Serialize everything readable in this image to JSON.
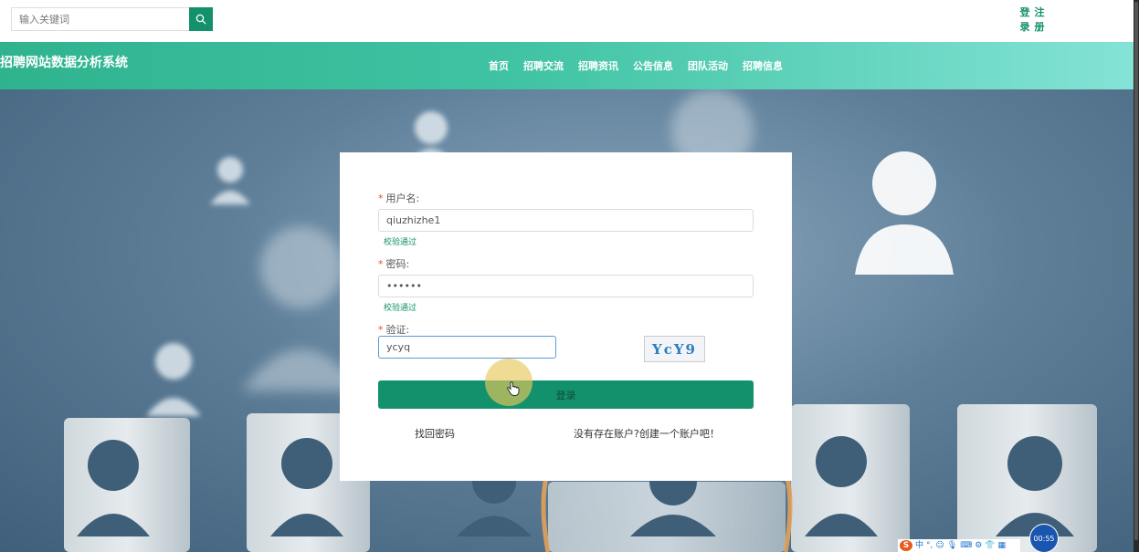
{
  "search": {
    "placeholder": "输入关键词"
  },
  "auth": {
    "login_chars": [
      "登",
      "录"
    ],
    "register_chars": [
      "注",
      "册"
    ]
  },
  "brand": {
    "title": "招聘网站数据分析系统"
  },
  "nav": {
    "items": [
      "首页",
      "招聘交流",
      "招聘资讯",
      "公告信息",
      "团队活动",
      "招聘信息"
    ]
  },
  "form": {
    "username": {
      "label": "用户名:",
      "value": "qiuzhizhe1",
      "hint": "校验通过"
    },
    "password": {
      "label": "密码:",
      "value": "••••••",
      "hint": "校验通过"
    },
    "captcha": {
      "label": "验证:",
      "value": "ycyq",
      "image_text": "YcY9"
    },
    "login_label": "登录",
    "forgot_label": "找回密码",
    "register_label": "没有存在账户?创建一个账户吧！"
  },
  "ime": {
    "logo": "S",
    "mode": "中",
    "items": [
      "°,",
      "☺",
      "🎙",
      "⌨",
      "⚙",
      "👕",
      "▦"
    ]
  },
  "timer": {
    "label": "00:55"
  },
  "colors": {
    "accent": "#13906c",
    "nav_gradient_start": "#2fb38f",
    "nav_gradient_end": "#84e3d6"
  },
  "icons": {
    "search": "search-icon",
    "cursor": "hand-cursor-icon"
  }
}
